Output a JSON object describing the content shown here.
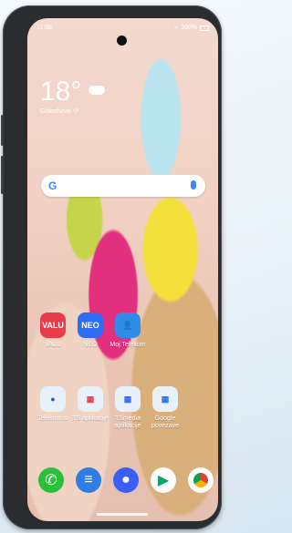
{
  "status": {
    "time": "11:08",
    "battery": "100%"
  },
  "weather": {
    "temp": "18°",
    "location": "Goleshovo"
  },
  "search": {
    "placeholder": ""
  },
  "apps_row1": [
    {
      "label": "VALU",
      "color": "#e83c4b"
    },
    {
      "label": "NEO",
      "color": "#2e6cf6"
    },
    {
      "label": "Moj Telekom",
      "color": "#2f8de7"
    }
  ],
  "apps_row2": [
    {
      "label": "Telekom.si",
      "color": "#e8f1f9"
    },
    {
      "label": "TS aplikacije",
      "color": "#e8f1f9"
    },
    {
      "label": "TSmedia aplikacije",
      "color": "#e8f1f9"
    },
    {
      "label": "Google povezave",
      "color": "#e8f1f9"
    }
  ],
  "dock": [
    {
      "name": "phone",
      "color": "#2bbf3b"
    },
    {
      "name": "messages",
      "color": "#2f7de6"
    },
    {
      "name": "camera",
      "color": "#3b5ff6"
    },
    {
      "name": "play-store",
      "color": "#ffffff"
    },
    {
      "name": "chrome",
      "color": "#ffffff"
    }
  ]
}
